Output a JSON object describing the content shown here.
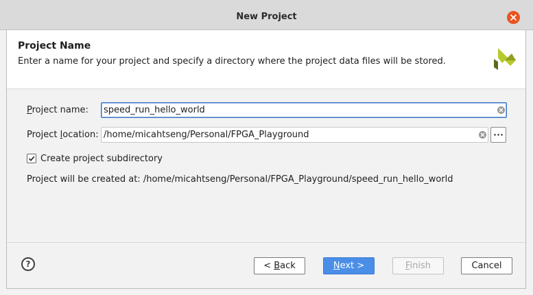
{
  "window": {
    "title": "New Project"
  },
  "header": {
    "title": "Project Name",
    "description": "Enter a name for your project and specify a directory where the project data files will be stored."
  },
  "form": {
    "name_label_mnemonic": "P",
    "name_label_rest": "roject name:",
    "name_value": "speed_run_hello_world",
    "location_label_before": "Project ",
    "location_label_mnemonic": "l",
    "location_label_after": "ocation:",
    "location_value": "/home/micahtseng/Personal/FPGA_Playground",
    "subdir_label": "Create project subdirectory",
    "subdir_checked": true,
    "created_at_label": "Project will be created at:",
    "created_at_path": "/home/micahtseng/Personal/FPGA_Playground/speed_run_hello_world"
  },
  "buttons": {
    "back_prefix": "< ",
    "back_mnemonic": "B",
    "back_rest": "ack",
    "next_mnemonic": "N",
    "next_rest": "ext >",
    "finish_mnemonic": "F",
    "finish_rest": "inish",
    "cancel": "Cancel",
    "help": "?"
  },
  "colors": {
    "accent": "#4a8ee8",
    "close": "#e95420",
    "logo_light": "#b8c92b",
    "logo_dark": "#5f6b1c"
  }
}
